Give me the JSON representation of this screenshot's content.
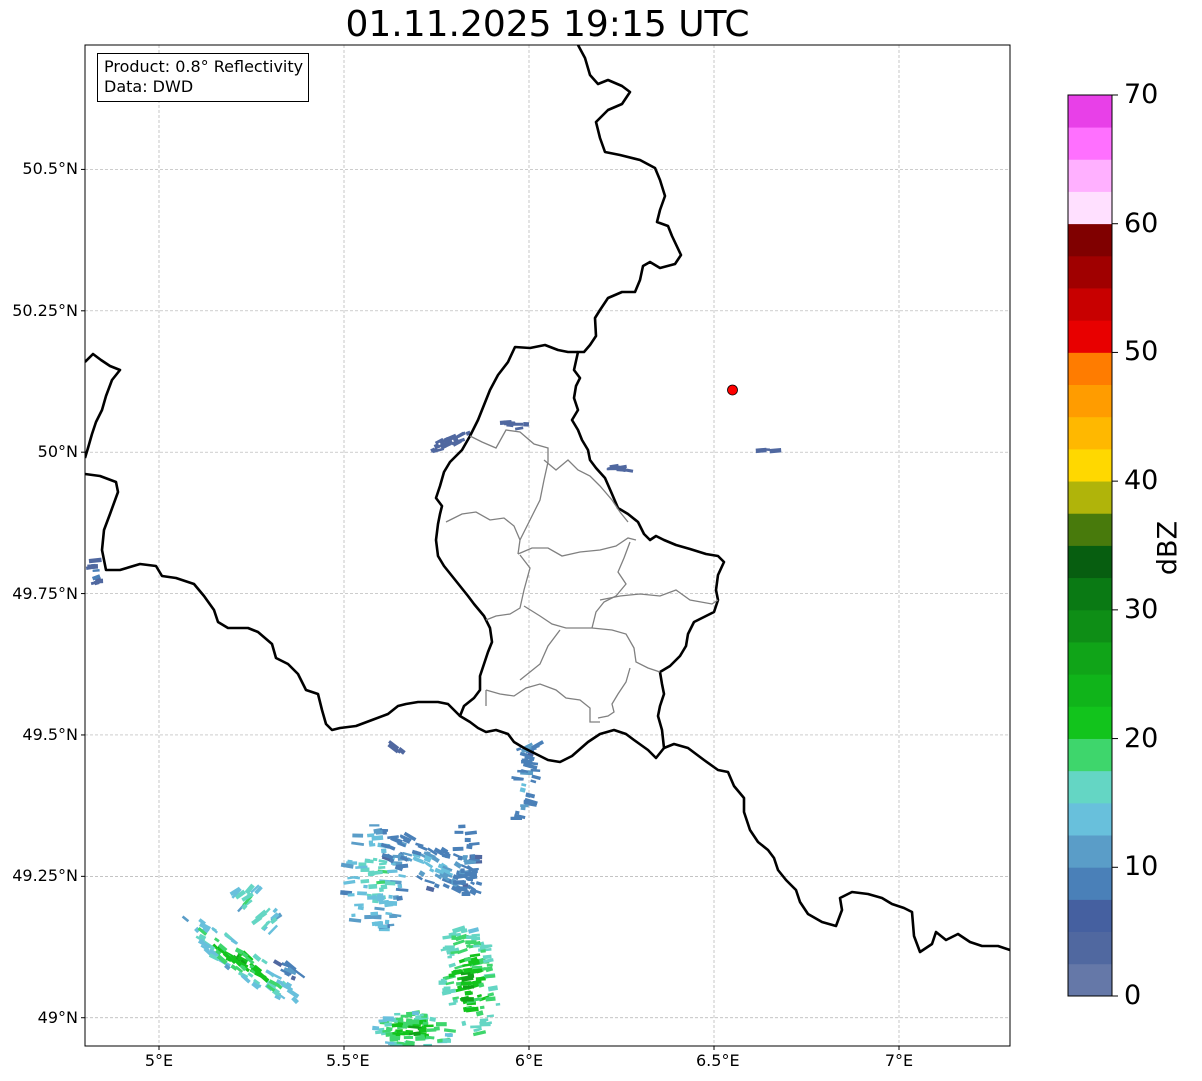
{
  "title": "01.11.2025 19:15 UTC",
  "info_box": {
    "product": "Product: 0.8° Reflectivity",
    "data": "Data: DWD"
  },
  "map": {
    "lon_range": [
      4.8,
      7.3
    ],
    "lat_range": [
      48.95,
      50.72
    ],
    "gridlines": true,
    "x_ticks": [
      "5°E",
      "5.5°E",
      "6°E",
      "6.5°E",
      "7°E"
    ],
    "y_ticks": [
      "49°N",
      "49.25°N",
      "49.5°N",
      "49.75°N",
      "50°N",
      "50.25°N",
      "50.5°N"
    ],
    "marker": {
      "lon": 6.55,
      "lat": 50.11,
      "color": "#ff0000"
    },
    "colors": {
      "country_border": "#000000",
      "district_border": "#808080",
      "gridline": "#b0b0b0"
    }
  },
  "colorbar": {
    "label": "dBZ",
    "min": 0,
    "max": 70,
    "ticks": [
      "0",
      "10",
      "20",
      "30",
      "40",
      "50",
      "60",
      "70"
    ],
    "colors": [
      "#6578a8",
      "#5068a0",
      "#4560a0",
      "#4a80b8",
      "#5a9dc8",
      "#68c0dc",
      "#64d6c4",
      "#3ed66c",
      "#12c41c",
      "#10b41a",
      "#10a418",
      "#0e8e16",
      "#0a7a14",
      "#075e10",
      "#487a0c",
      "#b0b40a",
      "#ffd800",
      "#ffb800",
      "#ff9c00",
      "#ff7c00",
      "#e80000",
      "#c80000",
      "#a00000",
      "#800000",
      "#ffe0ff",
      "#ffb0ff",
      "#ff70ff",
      "#e840e8"
    ]
  }
}
